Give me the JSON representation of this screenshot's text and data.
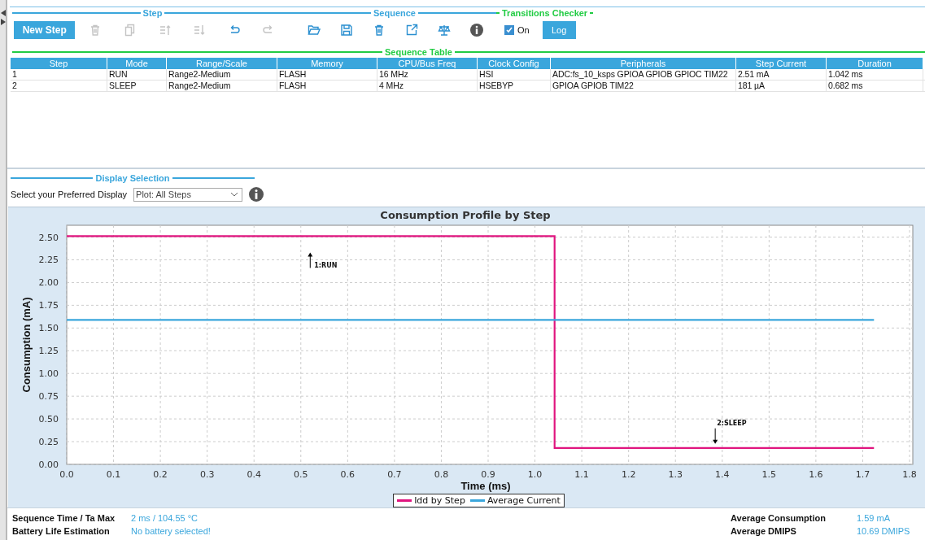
{
  "toolbar": {
    "groups": [
      {
        "title": "Step",
        "kind": "step",
        "new_button": "New Step",
        "tools": [
          {
            "disabled": true
          },
          {
            "disabled": true
          },
          {
            "disabled": true
          },
          {
            "disabled": true
          },
          {
            "disabled": false
          },
          {
            "disabled": true
          }
        ]
      },
      {
        "title": "Sequence",
        "kind": "sequence",
        "tools": [
          {
            "disabled": false
          },
          {
            "disabled": false
          },
          {
            "disabled": false
          },
          {
            "disabled": false
          },
          {
            "disabled": false
          },
          {
            "disabled": false
          }
        ]
      },
      {
        "title": "Transitions Checker",
        "kind": "checker",
        "checkbox": {
          "label": "On",
          "checked": true
        },
        "log_button": "Log"
      }
    ]
  },
  "sequence_table": {
    "title": "Sequence Table",
    "columns": [
      "Step",
      "Mode",
      "Range/Scale",
      "Memory",
      "CPU/Bus Freq",
      "Clock Config",
      "Peripherals",
      "Step Current",
      "Duration"
    ],
    "rows": [
      [
        "1",
        "RUN",
        "Range2-Medium",
        "FLASH",
        "16 MHz",
        "HSI",
        "ADC:fs_10_ksps GPIOA GPIOB GPIOC TIM22",
        "2.51 mA",
        "1.042 ms"
      ],
      [
        "2",
        "SLEEP",
        "Range2-Medium",
        "FLASH",
        "4 MHz",
        "HSEBYP",
        "GPIOA GPIOB TIM22",
        "181 µA",
        "0.682 ms"
      ]
    ]
  },
  "display_selection": {
    "title": "Display Selection",
    "label": "Select your Preferred Display",
    "value": "Plot: All Steps"
  },
  "chart": {
    "chart_data": {
      "type": "line",
      "title": "Consumption Profile by Step",
      "xlabel": "Time (ms)",
      "ylabel": "Consumption (mA)",
      "series": [
        {
          "name": "Idd by Step",
          "color": "#e0157f",
          "x": [
            0,
            1.042,
            1.042,
            1.724
          ],
          "values": [
            2.51,
            2.51,
            0.18,
            0.18
          ]
        },
        {
          "name": "Average Current",
          "color": "#3aa6dc",
          "x": [
            0,
            1.724
          ],
          "values": [
            1.59,
            1.59
          ]
        }
      ],
      "xlim": [
        0,
        1.8
      ],
      "ylim": [
        0,
        2.63
      ],
      "grid": true,
      "xticks": [
        {
          "value": 0,
          "label": "0.0"
        },
        0.1,
        0.2,
        0.3,
        0.4,
        0.5,
        0.6,
        0.7,
        0.8,
        0.9,
        {
          "value": 1,
          "label": "1.0"
        },
        1.1,
        1.2,
        1.3,
        1.4,
        1.5,
        1.6,
        1.7,
        1.8
      ],
      "yticks": [
        {
          "value": 0,
          "label": "0.00"
        },
        {
          "value": 0.25,
          "label": "0.25"
        },
        {
          "value": 0.5,
          "label": "0.50"
        },
        {
          "value": 0.75,
          "label": "0.75"
        },
        {
          "value": 1,
          "label": "1.00"
        },
        {
          "value": 1.25,
          "label": "1.25"
        },
        {
          "value": 1.5,
          "label": "1.50"
        },
        {
          "value": 1.75,
          "label": "1.75"
        },
        {
          "value": 2,
          "label": "2.00"
        },
        {
          "value": 2.25,
          "label": "2.25"
        },
        {
          "value": 2.5,
          "label": "2.50"
        }
      ],
      "annotations": [
        "1:RUN",
        "2:SLEEP"
      ]
    }
  },
  "summary": {
    "left": [
      {
        "label": "Sequence Time / Ta Max",
        "value": "2 ms / 104.55 °C"
      },
      {
        "label": "Battery Life Estimation",
        "value": "No battery selected!"
      }
    ],
    "right": [
      {
        "label": "Average Consumption",
        "value": "1.59 mA"
      },
      {
        "label": "Average DMIPS",
        "value": "10.69 DMIPS"
      }
    ]
  }
}
